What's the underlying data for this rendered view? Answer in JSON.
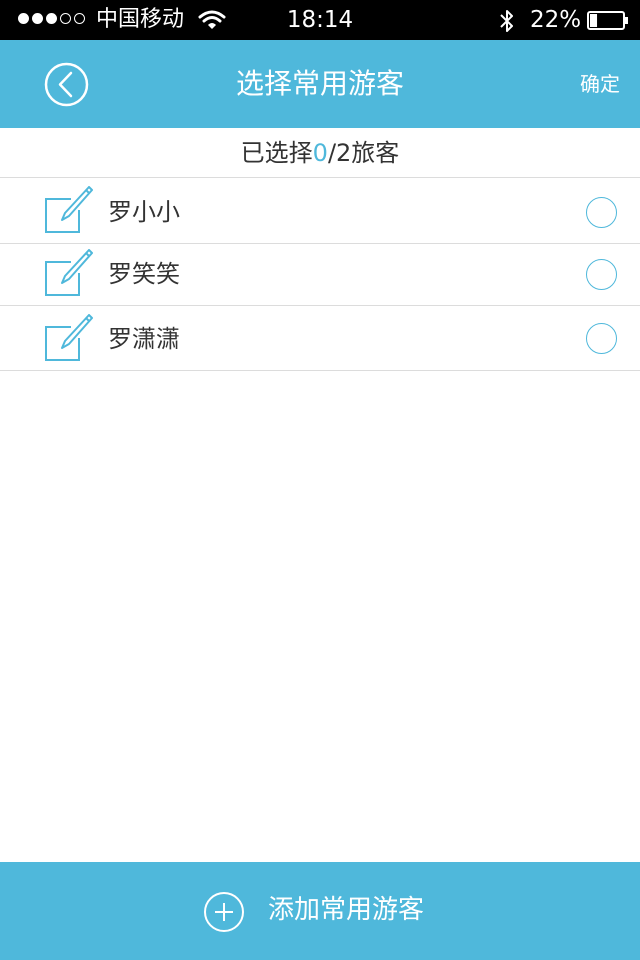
{
  "colors": {
    "accent": "#4fb8db",
    "status_bar": "#000000",
    "text": "#333333",
    "divider": "#dcdcdc"
  },
  "status_bar": {
    "carrier": "中国移动",
    "time": "18:14",
    "battery_percent": "22%",
    "battery_level": 0.22,
    "signal_bars_filled": 3,
    "signal_bars_total": 5
  },
  "nav": {
    "back_icon": "chevron-left-circle-icon",
    "title": "选择常用游客",
    "confirm_label": "确定"
  },
  "selection": {
    "prefix": "已选择",
    "selected": "0",
    "suffix": "/2旅客"
  },
  "travelers": [
    {
      "name": "罗小小",
      "selected": false
    },
    {
      "name": "罗笑笑",
      "selected": false
    },
    {
      "name": "罗潇潇",
      "selected": false
    }
  ],
  "add_bar": {
    "icon": "plus-circle-icon",
    "label": "添加常用游客"
  }
}
